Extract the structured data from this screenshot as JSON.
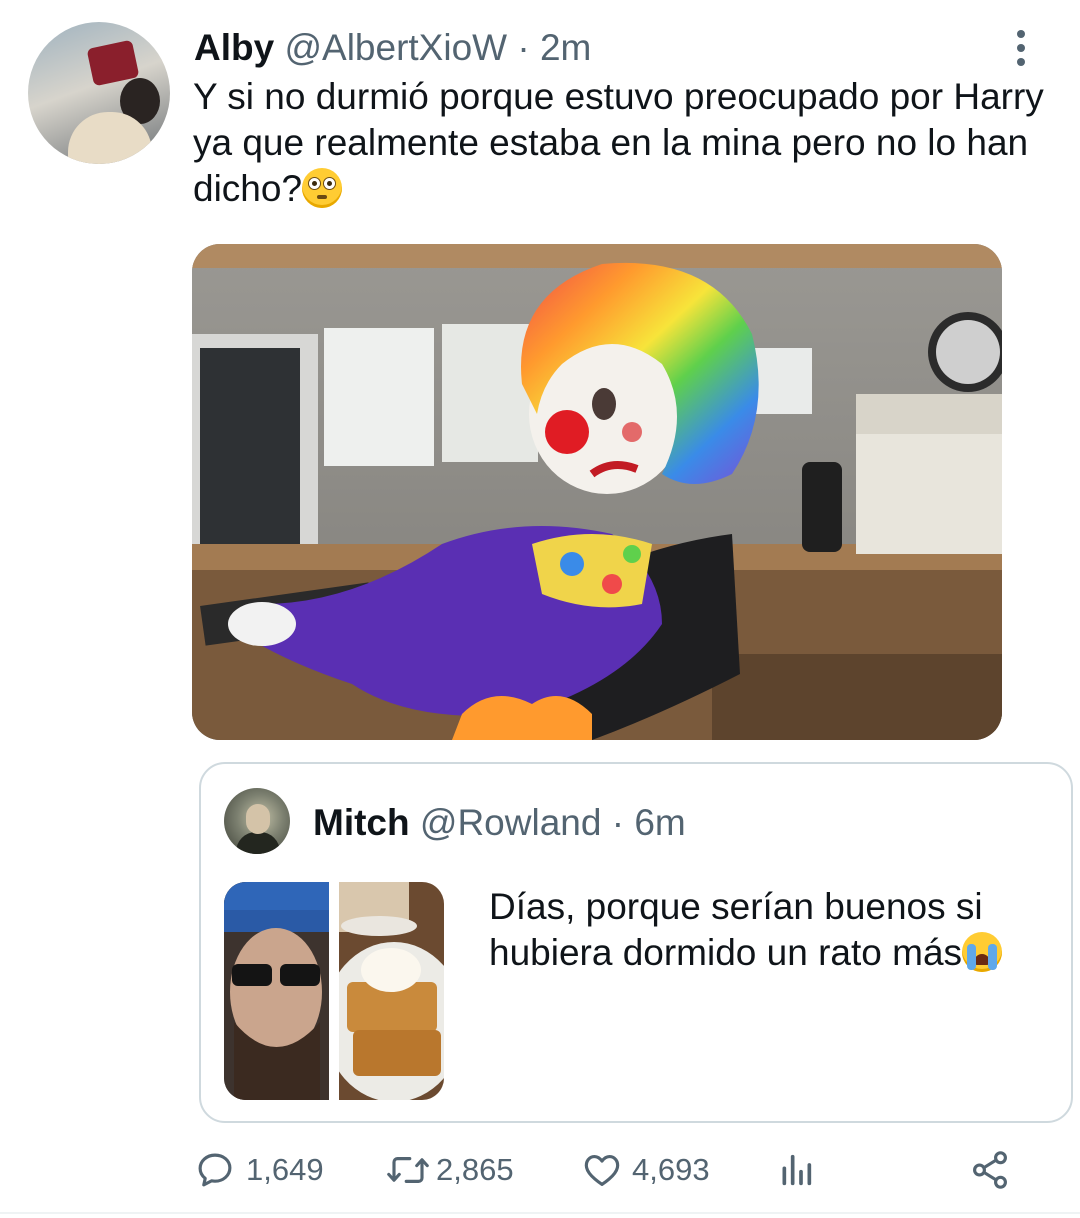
{
  "tweet": {
    "display_name": "Alby",
    "handle": "@AlbertXioW",
    "separator": "·",
    "time": "2m",
    "text": "Y si no durmió porque estuvo preocupado por Harry ya que realmente estaba en la mina pero no lo han dicho?",
    "text_emoji": "flushed-face-emoji"
  },
  "quote": {
    "display_name": "Mitch",
    "handle": "@Rowland",
    "separator": "·",
    "time": "6m",
    "text": "Días, porque serían buenos si hubiera dormido un rato más",
    "text_emoji": "loudly-crying-face-emoji"
  },
  "actions": {
    "reply_count": "1,649",
    "retweet_count": "2,865",
    "like_count": "4,693"
  },
  "icons": {
    "more": "more-vertical-icon",
    "reply": "reply-icon",
    "retweet": "retweet-icon",
    "like": "heart-icon",
    "analytics": "analytics-icon",
    "share": "share-icon"
  },
  "colors": {
    "text_primary": "#0f1419",
    "text_secondary": "#536471",
    "border": "#cfd9de"
  }
}
